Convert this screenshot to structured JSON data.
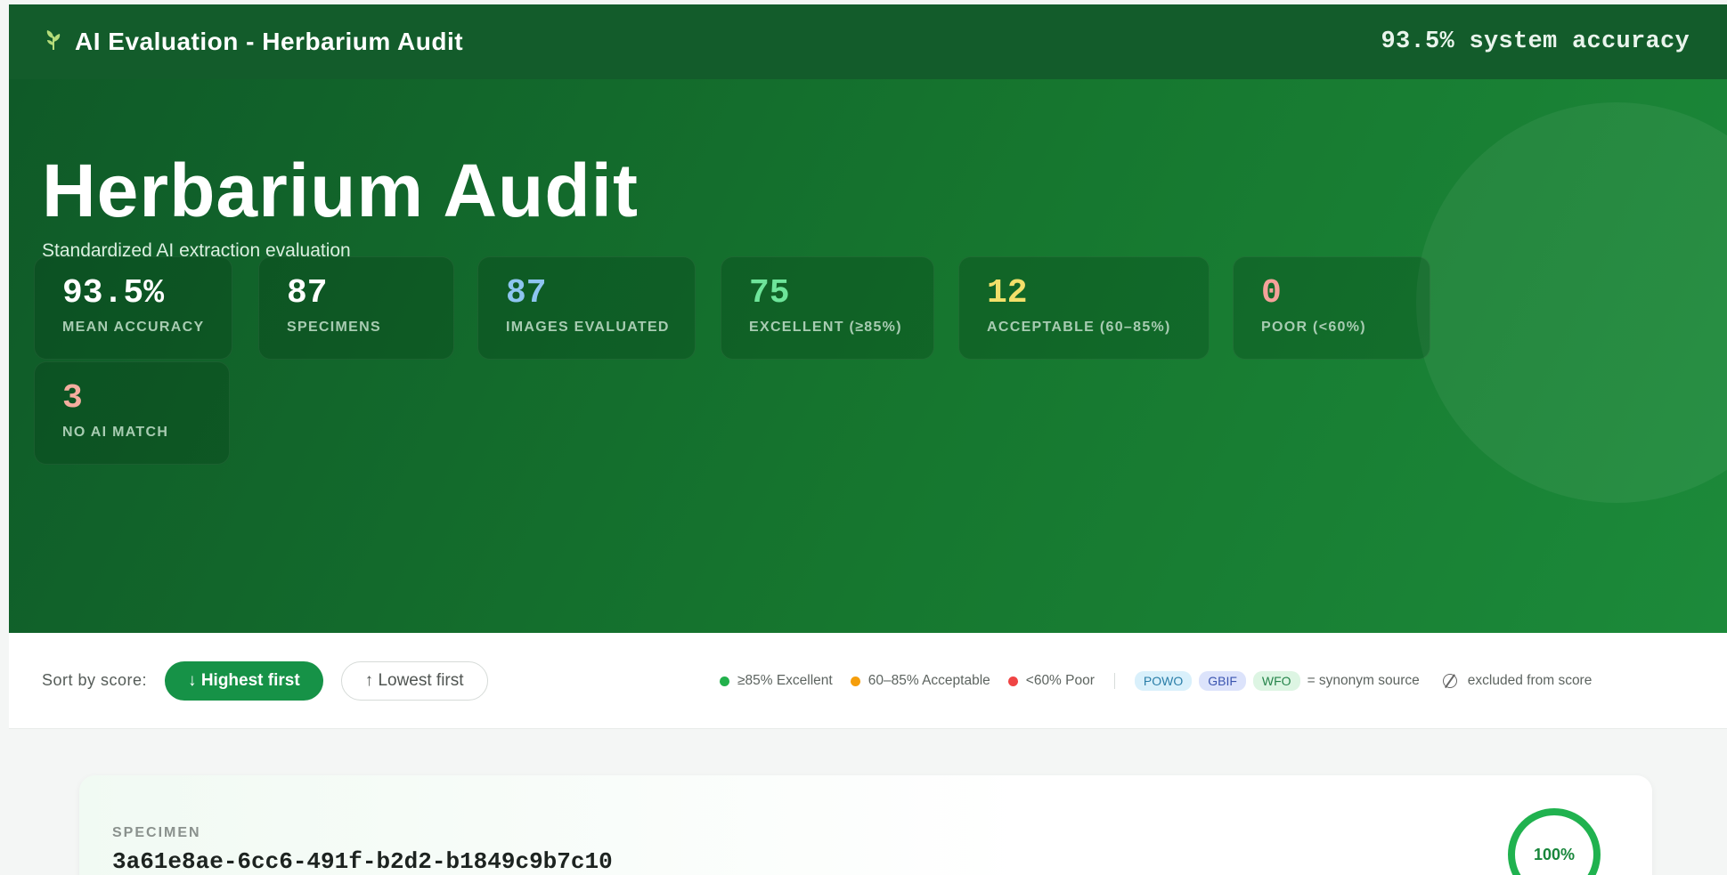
{
  "topbar": {
    "icon": "leaf-icon",
    "title": "AI Evaluation - Herbarium Audit",
    "system_accuracy": "93.5% system accuracy"
  },
  "hero": {
    "title": "Herbarium Audit",
    "subtitle": "Standardized AI extraction evaluation",
    "stats": [
      {
        "value": "93.5%",
        "label": "MEAN ACCURACY",
        "color": "#ffffff"
      },
      {
        "value": "87",
        "label": "SPECIMENS",
        "color": "#ffffff"
      },
      {
        "value": "87",
        "label": "IMAGES EVALUATED",
        "color": "#8ec5f0"
      },
      {
        "value": "75",
        "label": "EXCELLENT (≥85%)",
        "color": "#6ee59a"
      },
      {
        "value": "12",
        "label": "ACCEPTABLE (60–85%)",
        "color": "#f3e06a"
      },
      {
        "value": "0",
        "label": "POOR (<60%)",
        "color": "#f5a29a"
      },
      {
        "value": "3",
        "label": "NO AI MATCH",
        "color": "#f5ad9f"
      }
    ]
  },
  "controls": {
    "sort_label": "Sort by score:",
    "btn_highest": "↓ Highest first",
    "btn_lowest": "↑ Lowest first",
    "legend": {
      "excellent": {
        "label": "≥85% Excellent",
        "color": "#22b14c"
      },
      "acceptable": {
        "label": "60–85% Acceptable",
        "color": "#f59e0b"
      },
      "poor": {
        "label": "<60% Poor",
        "color": "#ef4444"
      },
      "sources": [
        {
          "label": "POWO",
          "bg": "#d9f0fb",
          "fg": "#2a7ea8"
        },
        {
          "label": "GBIF",
          "bg": "#dce3fb",
          "fg": "#3b55b0"
        },
        {
          "label": "WFO",
          "bg": "#ddf5e3",
          "fg": "#25844a"
        }
      ],
      "synonym_text": "= synonym source",
      "excluded_text": "excluded from score"
    }
  },
  "specimen": {
    "label": "SPECIMEN",
    "id": "3a61e8ae-6cc6-491f-b2d2-b1849c9b7c10",
    "score": "100%"
  }
}
